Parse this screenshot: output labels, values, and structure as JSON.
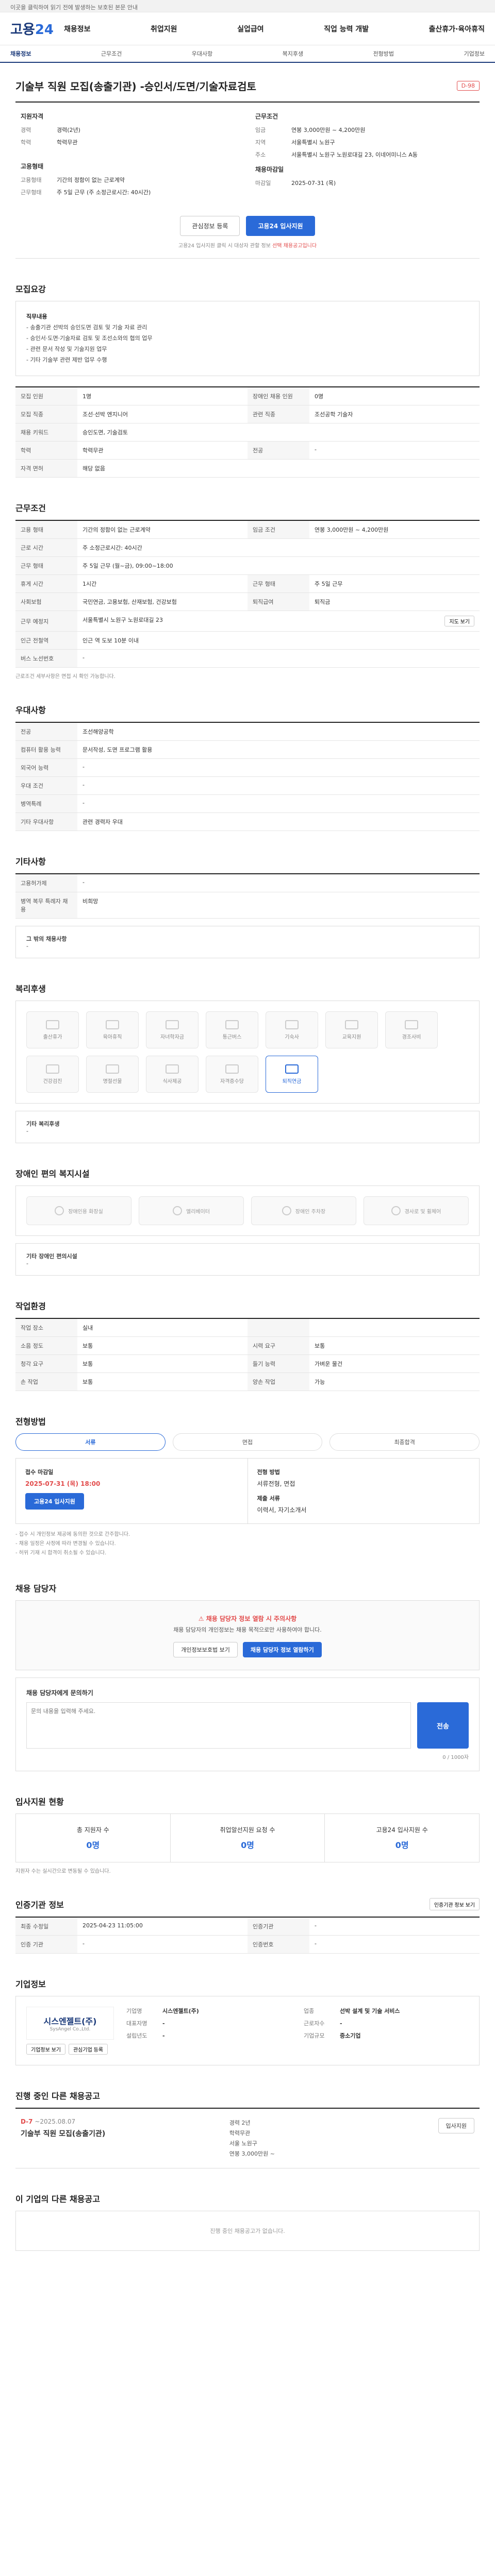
{
  "topbar": {
    "text": "이곳을 클릭하여 읽기 전에 발생하는 보호된 본문 안내"
  },
  "header": {
    "logo_main": "고용",
    "logo_num": "24",
    "nav": [
      "채용정보",
      "취업지원",
      "실업급여",
      "직업 능력 개발",
      "출산휴가·육아휴직"
    ]
  },
  "subnav": [
    "채용정보",
    "근무조건",
    "우대사항",
    "복지후생",
    "전형방법",
    "기업정보"
  ],
  "job": {
    "title": "기술부 직원 모집(송출기관) -승인서/도면/기술자료검토",
    "badge": "D-98"
  },
  "summary": {
    "left_title": "지원자격",
    "left": [
      {
        "k": "경력",
        "v": "경력(2년)"
      },
      {
        "k": "학력",
        "v": "학력무관"
      }
    ],
    "left2_title": "고용형태",
    "left2": [
      {
        "k": "고용형태",
        "v": "기간의 정함이 없는 근로계약"
      },
      {
        "k": "근무형태",
        "v": "주 5일 근무 (주 소정근로시간: 40시간)"
      }
    ],
    "right_title": "근무조건",
    "right": [
      {
        "k": "임금",
        "v": "연봉 3,000만원 ~ 4,200만원"
      },
      {
        "k": "지역",
        "v": "서울특별시 노원구"
      },
      {
        "k": "주소",
        "v": "서울특별시 노원구 노원로대길 23, 이네어미니스 A동"
      }
    ],
    "right2_title": "채용마감일",
    "right2": [
      {
        "k": "마감일",
        "v": "2025-07-31 (목)"
      }
    ]
  },
  "apply": {
    "save": "관심정보 등록",
    "apply": "고용24 입사지원",
    "note": "고용24 입사지원 클릭 시 대상자 관할 정보",
    "note_red": "선택 채용공고입니다"
  },
  "recruit": {
    "title": "모집요강",
    "body_title": "직무내용",
    "lines": [
      "- 송출기관 선박의 승인도면 검토 및 기술 자료 관리",
      "- 승인서·도면·기술자료 검토 및 조선소와의 협의 업무",
      "- 관련 문서 작성 및 기술지원 업무",
      "- 기타 기술부 관련 제반 업무 수행"
    ],
    "rows": [
      {
        "k": "모집 인원",
        "v": "1명",
        "k2": "장애인 채용 인원",
        "v2": "0명"
      },
      {
        "k": "모집 직종",
        "v": "조선·선박 엔지니어",
        "k2": "관련 직종",
        "v2": "조선공학 기술자"
      },
      {
        "k": "채용 키워드",
        "v": "승인도면, 기술검토"
      },
      {
        "k": "학력",
        "v": "학력무관",
        "k2": "전공",
        "v2": "-"
      },
      {
        "k": "자격 면허",
        "v": "해당 없음"
      }
    ]
  },
  "conditions": {
    "title": "근무조건",
    "rows": [
      {
        "k": "고용 형태",
        "v": "기간의 정함이 없는 근로계약",
        "k2": "임금 조건",
        "v2": "연봉 3,000만원 ~ 4,200만원"
      },
      {
        "k": "근로 시간",
        "v": "주 소정근로시간: 40시간"
      },
      {
        "k": "근무 형태",
        "v": "주 5일 근무 (월~금), 09:00~18:00"
      },
      {
        "k": "휴게 시간",
        "v": "1시간",
        "k2": "근무 형태",
        "v2": "주 5일 근무"
      },
      {
        "k": "사회보험",
        "v": "국민연금, 고용보험, 산재보험, 건강보험",
        "k2": "퇴직급여",
        "v2": "퇴직금"
      },
      {
        "k": "근무 예정지",
        "v": "서울특별시 노원구 노원로대길 23",
        "btn": "지도 보기"
      },
      {
        "k": "인근 전철역",
        "v": "인근 역 도보 10분 이내"
      },
      {
        "k": "버스 노선번호",
        "v": "-"
      }
    ],
    "note": "근로조건 세부사항은 면접 시 확인 가능합니다."
  },
  "preference": {
    "title": "우대사항",
    "rows": [
      {
        "k": "전공",
        "v": "조선해양공학"
      },
      {
        "k": "컴퓨터 활용 능력",
        "v": "문서작성, 도면 프로그램 활용"
      },
      {
        "k": "외국어 능력",
        "v": "-"
      },
      {
        "k": "우대 조건",
        "v": "-"
      },
      {
        "k": "병역특례",
        "v": "-"
      },
      {
        "k": "기타 우대사항",
        "v": "관련 경력자 우대"
      }
    ]
  },
  "etc": {
    "title": "기타사항",
    "rows": [
      {
        "k": "고용허가제",
        "v": "-"
      },
      {
        "k": "병역 복무 특례자 채용",
        "v": "비희망"
      }
    ],
    "extra_label": "그 밖의 채용사항",
    "extra": "-"
  },
  "welfare": {
    "title": "복리후생",
    "items": [
      "출산휴가",
      "육아휴직",
      "자녀학자금",
      "통근버스",
      "기숙사",
      "교육지원",
      "경조사비",
      "건강검진",
      "명절선물",
      "식사제공",
      "자격증수당",
      "퇴직연금"
    ],
    "on_index": 11,
    "other_label": "기타 복리후생",
    "other": "-"
  },
  "disability": {
    "title": "장애인 편의 복지시설",
    "items": [
      "장애인용 화장실",
      "엘리베이터",
      "장애인 주차장",
      "경사로 및 휠체어"
    ],
    "other_label": "기타 장애인 편의시설",
    "other": "-"
  },
  "workenv": {
    "title": "작업환경",
    "rows": [
      {
        "k": "작업 장소",
        "v": "실내",
        "k2": "",
        "v2": ""
      },
      {
        "k": "소음 정도",
        "v": "보통",
        "k2": "시력 요구",
        "v2": "보통"
      },
      {
        "k": "청각 요구",
        "v": "보통",
        "k2": "들기 능력",
        "v2": "가벼운 물건"
      },
      {
        "k": "손 작업",
        "v": "보통",
        "k2": "양손 작업",
        "v2": "가능"
      }
    ]
  },
  "process": {
    "title": "전형방법",
    "tabs": [
      "서류",
      "면접",
      "최종합격"
    ],
    "deadline_label": "접수 마감일",
    "deadline": "2025-07-31 (목) 18:00",
    "apply_btn": "고용24 입사지원",
    "method_label": "전형 방법",
    "method": "서류전형, 면접",
    "docs_label": "제출 서류",
    "docs": "이력서, 자기소개서",
    "bullets": [
      "- 접수 시 개인정보 제공에 동의한 것으로 간주합니다.",
      "- 채용 일정은 사정에 따라 변경될 수 있습니다.",
      "- 허위 기재 시 합격이 취소될 수 있습니다."
    ]
  },
  "contact": {
    "title": "채용 담당자",
    "warn": "채용 담당자 정보 열람 시 주의사항",
    "warn_text": "채용 담당자의 개인정보는 채용 목적으로만 사용하여야 합니다.",
    "b1": "개인정보보호법 보기",
    "b2": "채용 담당자 정보 열람하기",
    "inq_title": "채용 담당자에게 문의하기",
    "inq_ph": "문의 내용을 입력해 주세요.",
    "send": "전송",
    "count": "0 / 1000자"
  },
  "status": {
    "title": "입사지원 현황",
    "items": [
      {
        "k": "총 지원자 수",
        "v": "0명"
      },
      {
        "k": "취업알선지원 요청 수",
        "v": "0명"
      },
      {
        "k": "고용24 입사지원 수",
        "v": "0명"
      }
    ],
    "note": "지원자 수는 실시간으로 변동될 수 있습니다."
  },
  "cert": {
    "title": "인증기관 정보",
    "btn": "인증기관 정보 보기",
    "rows": [
      {
        "k": "최종 수정일",
        "v": "2025-04-23 11:05:00",
        "k2": "인증기관",
        "v2": "-"
      },
      {
        "k": "인증 기관",
        "v": "-",
        "k2": "인증번호",
        "v2": "-"
      }
    ]
  },
  "company": {
    "title": "기업정보",
    "name": "시스엔젤트(주)",
    "en": "SysAngel Co.,Ltd.",
    "info": [
      {
        "k": "기업명",
        "v": "시스엔젤트(주)"
      },
      {
        "k": "업종",
        "v": "선박 설계 및 기술 서비스"
      },
      {
        "k": "대표자명",
        "v": "-"
      },
      {
        "k": "근로자수",
        "v": "-"
      },
      {
        "k": "설립년도",
        "v": "-"
      },
      {
        "k": "기업규모",
        "v": "중소기업"
      }
    ],
    "b1": "기업정보 보기",
    "b2": "관심기업 등록"
  },
  "other_jobs": {
    "title": "진행 중인 다른 채용공고",
    "dday": "D-7",
    "date": "~2025.08.07",
    "name": "기술부 직원 모집(송출기관)",
    "details": [
      "경력 2년",
      "학력무관",
      "서울 노원구",
      "연봉 3,000만원 ~"
    ],
    "btn": "입사지원"
  },
  "other_empty": {
    "title": "이 기업의 다른 채용공고",
    "text": "진행 중인 채용공고가 없습니다."
  }
}
